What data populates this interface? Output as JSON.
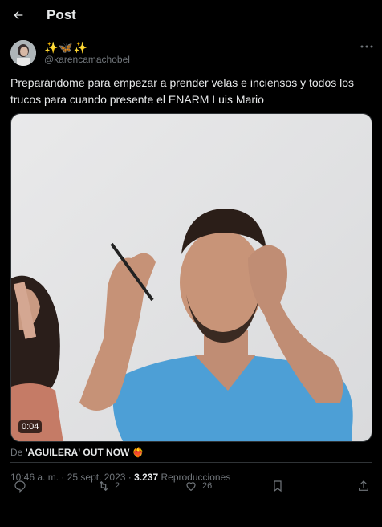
{
  "header": {
    "title": "Post"
  },
  "post": {
    "display_name": "✨🦋✨",
    "handle": "@karencamachobel",
    "text": "Preparándome para empezar a prender velas e inciensos y todos los trucos para cuando presente el ENARM Luis Mario",
    "video_time": "0:04",
    "source_prefix": "De ",
    "source_name": "'AGUILERA' OUT NOW",
    "source_emoji": "❤️‍🔥",
    "time": "10:46 a. m.",
    "sep1": " · ",
    "date": "25 sept. 2023",
    "sep2": " · ",
    "views": "3.237",
    "views_label": " Reproducciones"
  },
  "actions": {
    "reply_count": "",
    "repost_count": "2",
    "like_count": "26"
  },
  "icons": [
    "back-arrow-icon",
    "more-icon",
    "reply-icon",
    "repost-icon",
    "like-icon",
    "bookmark-icon",
    "share-icon"
  ]
}
